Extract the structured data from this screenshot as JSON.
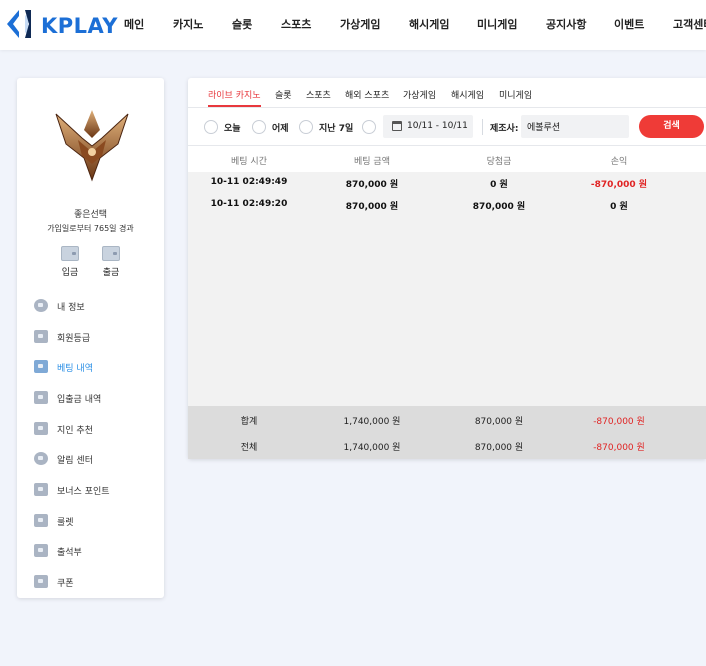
{
  "brand": {
    "name": "KPLAY",
    "accent": "#1c6fd6"
  },
  "nav": [
    "메인",
    "카지노",
    "슬롯",
    "스포츠",
    "가상게임",
    "해시게임",
    "미니게임",
    "공지사항",
    "이벤트",
    "고객센터"
  ],
  "user": {
    "name": "좋은선택",
    "joined": "가입일로부터 765일 경과",
    "deposit_label": "입금",
    "withdraw_label": "출금"
  },
  "menu": [
    "내 정보",
    "회원등급",
    "베팅 내역",
    "입출금 내역",
    "지인 추천",
    "알림 센터",
    "보너스 포인트",
    "룰렛",
    "출석부",
    "쿠폰"
  ],
  "active_menu": "베팅 내역",
  "tabs": [
    "라이브 카지노",
    "슬롯",
    "스포츠",
    "해외 스포츠",
    "가상게임",
    "해시게임",
    "미니게임"
  ],
  "active_tab": "라이브 카지노",
  "filters": {
    "options": [
      "오늘",
      "어제",
      "지난 7일"
    ],
    "date_range": "10/11 - 10/11",
    "provider_label": "제조사:",
    "provider_value": "에볼루션",
    "search_label": "검색"
  },
  "table": {
    "headers": [
      "베팅 시간",
      "베팅 금액",
      "당첨금",
      "손익"
    ],
    "rows": [
      {
        "time": "10-11 02:49:49",
        "bet": "870,000 원",
        "win": "0 원",
        "profit": "-870,000 원"
      },
      {
        "time": "10-11 02:49:20",
        "bet": "870,000 원",
        "win": "870,000 원",
        "profit": "0 원"
      }
    ],
    "footer": [
      {
        "label": "합계",
        "bet": "1,740,000 원",
        "win": "870,000 원",
        "profit": "-870,000 원"
      },
      {
        "label": "전체",
        "bet": "1,740,000 원",
        "win": "870,000 원",
        "profit": "-870,000 원"
      }
    ]
  },
  "colors": {
    "negative": "#e02424",
    "search_button": "#ef3b37",
    "active_tab": "#e8383d",
    "active_menu": "#2a8fe6"
  }
}
